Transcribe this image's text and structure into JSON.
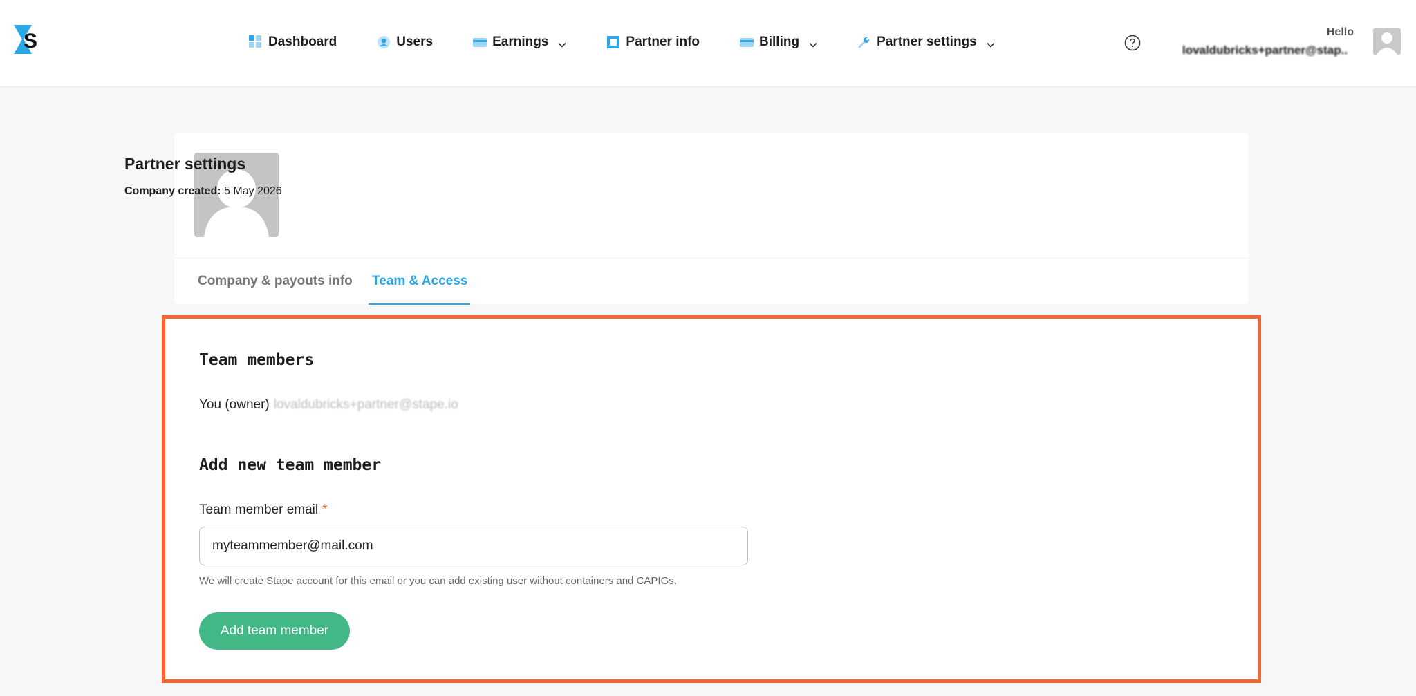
{
  "brand": {
    "logo_letter": "S"
  },
  "nav": {
    "items": [
      {
        "label": "Dashboard",
        "icon": "dashboard-icon",
        "has_dropdown": false
      },
      {
        "label": "Users",
        "icon": "users-icon",
        "has_dropdown": false
      },
      {
        "label": "Earnings",
        "icon": "card-icon",
        "has_dropdown": true
      },
      {
        "label": "Partner info",
        "icon": "info-square-icon",
        "has_dropdown": false
      },
      {
        "label": "Billing",
        "icon": "card-icon",
        "has_dropdown": true
      },
      {
        "label": "Partner settings",
        "icon": "wrench-icon",
        "has_dropdown": true
      }
    ]
  },
  "header": {
    "greeting": "Hello",
    "user_email": "lovaldubricks+partner@stap..."
  },
  "profile": {
    "title": "Partner settings",
    "created_label": "Company created:",
    "created_value": "5 May 2026"
  },
  "tabs": [
    {
      "label": "Company & payouts info",
      "active": false
    },
    {
      "label": "Team & Access",
      "active": true
    }
  ],
  "team": {
    "members_heading": "Team members",
    "owner_label": "You (owner)",
    "owner_email": "lovaldubricks+partner@stape.io",
    "add_heading": "Add new team member",
    "email_label": "Team member email",
    "required_mark": "*",
    "email_value": "myteammember@mail.com",
    "hint": "We will create Stape account for this email or you can add existing user without containers and CAPIGs.",
    "add_button": "Add team member"
  },
  "colors": {
    "accent_blue": "#2aa7e4",
    "button_green": "#42b887",
    "highlight_orange": "#f2672f",
    "background": "#f6f7f9"
  }
}
